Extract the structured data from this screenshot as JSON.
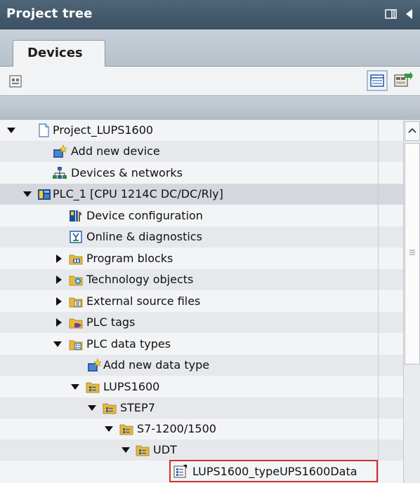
{
  "header": {
    "title": "Project tree"
  },
  "tabs": [
    {
      "label": "Devices"
    }
  ],
  "tree": {
    "items": [
      {
        "label": "Project_LUPS1600",
        "icon": "project-icon",
        "expander": "expanded"
      },
      {
        "label": "Add new device",
        "icon": "add-device-icon",
        "expander": "none"
      },
      {
        "label": "Devices & networks",
        "icon": "network-icon",
        "expander": "none"
      },
      {
        "label": "PLC_1 [CPU 1214C DC/DC/Rly]",
        "icon": "plc-icon",
        "expander": "expanded"
      },
      {
        "label": "Device configuration",
        "icon": "device-config-icon",
        "expander": "none"
      },
      {
        "label": "Online & diagnostics",
        "icon": "diagnostics-icon",
        "expander": "none"
      },
      {
        "label": "Program blocks",
        "icon": "folder-program-icon",
        "expander": "collapsed"
      },
      {
        "label": "Technology objects",
        "icon": "folder-technology-icon",
        "expander": "collapsed"
      },
      {
        "label": "External source files",
        "icon": "folder-source-icon",
        "expander": "collapsed"
      },
      {
        "label": "PLC tags",
        "icon": "folder-tags-icon",
        "expander": "collapsed"
      },
      {
        "label": "PLC data types",
        "icon": "folder-datatypes-icon",
        "expander": "expanded"
      },
      {
        "label": "Add new data type",
        "icon": "add-datatype-icon",
        "expander": "none"
      },
      {
        "label": "LUPS1600",
        "icon": "folder-group-icon",
        "expander": "expanded"
      },
      {
        "label": "STEP7",
        "icon": "folder-group-icon",
        "expander": "expanded"
      },
      {
        "label": "S7-1200/1500",
        "icon": "folder-group-icon",
        "expander": "expanded"
      },
      {
        "label": "UDT",
        "icon": "folder-group-icon",
        "expander": "expanded"
      },
      {
        "label": "LUPS1600_typeUPS1600Data",
        "icon": "datatype-icon",
        "expander": "none",
        "highlighted": true
      }
    ]
  },
  "colors": {
    "titlebar": "#3f5466",
    "highlight_border": "#d22f2f",
    "folder": "#e8b93a"
  }
}
